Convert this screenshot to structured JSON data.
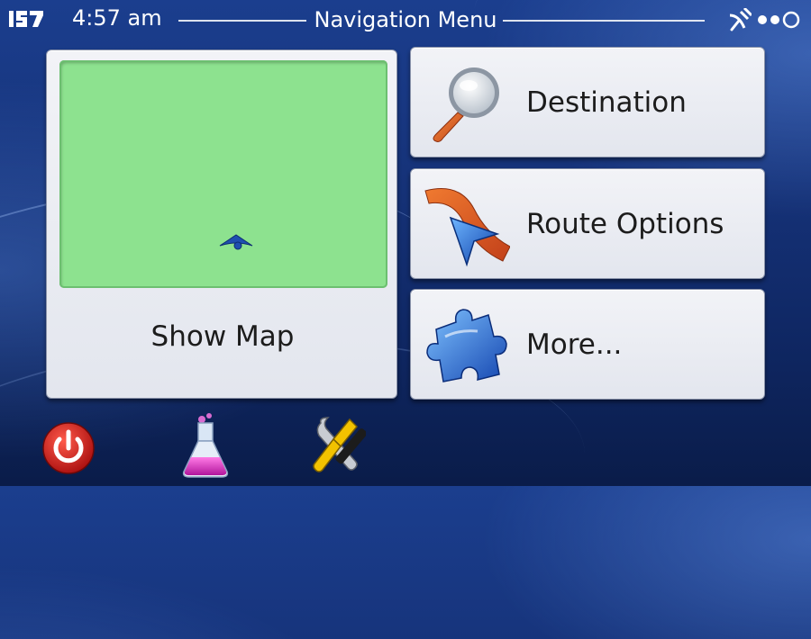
{
  "statusbar": {
    "logo_text": "IGO",
    "time": "4:57 am",
    "title": "Navigation Menu"
  },
  "map_panel": {
    "label": "Show Map",
    "map_color": "#8de28f"
  },
  "menu": {
    "destination": {
      "label": "Destination",
      "icon": "magnifier-icon"
    },
    "route_options": {
      "label": "Route Options",
      "icon": "route-arrow-icon"
    },
    "more": {
      "label": "More...",
      "icon": "puzzle-piece-icon"
    }
  },
  "bottom_bar": [
    {
      "icon": "power-icon"
    },
    {
      "icon": "flask-icon"
    },
    {
      "icon": "tools-icon"
    }
  ],
  "colors": {
    "background": "#16337a",
    "panel": "#e9ebf1",
    "power_red": "#d42020",
    "accent_orange": "#e8641c"
  }
}
